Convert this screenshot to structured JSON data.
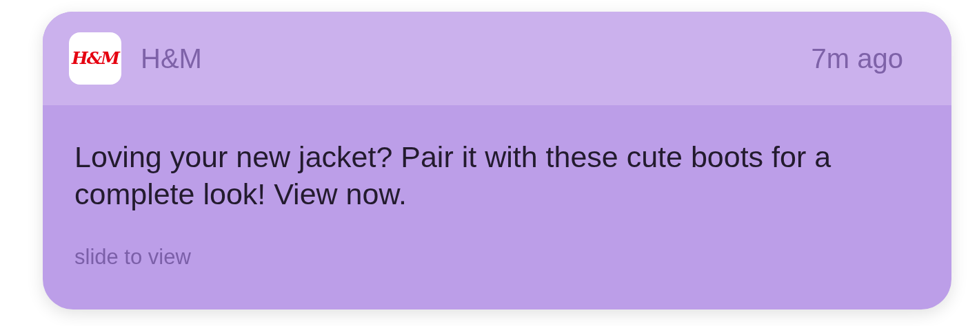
{
  "notification": {
    "app_icon_text": "H&M",
    "app_name": "H&M",
    "time": "7m ago",
    "message": "Loving your new jacket? Pair it with these cute boots for a complete look! View now.",
    "hint": "slide to view"
  }
}
